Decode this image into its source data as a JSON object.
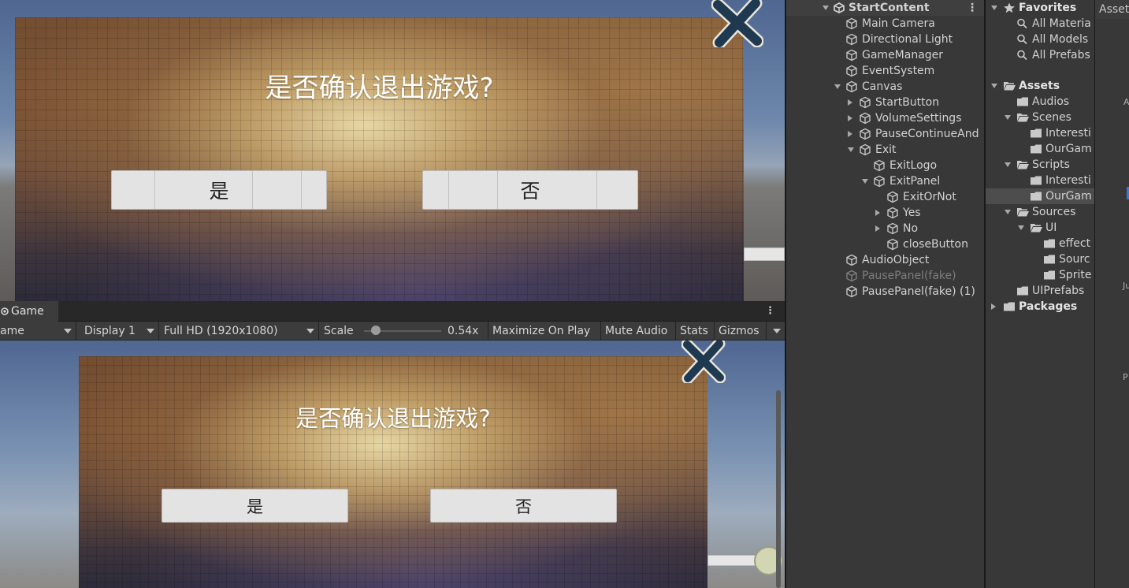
{
  "scene": {
    "dialog_title": "是否确认退出游戏?",
    "yes_label": "是",
    "no_label": "否"
  },
  "game": {
    "tab_label": "Game",
    "toolbar": {
      "view_mode": "ame",
      "display": "Display 1",
      "resolution": "Full HD (1920x1080)",
      "scale_label": "Scale",
      "scale_value": "0.54x",
      "maximize": "Maximize On Play",
      "mute": "Mute Audio",
      "stats": "Stats",
      "gizmos": "Gizmos"
    },
    "dialog_title": "是否确认退出游戏?",
    "yes_label": "是",
    "no_label": "否"
  },
  "hierarchy": {
    "scene_name": "StartContent",
    "items": [
      {
        "label": "Main Camera"
      },
      {
        "label": "Directional Light"
      },
      {
        "label": "GameManager"
      },
      {
        "label": "EventSystem"
      },
      {
        "label": "Canvas"
      },
      {
        "label": "StartButton"
      },
      {
        "label": "VolumeSettings"
      },
      {
        "label": "PauseContinueAnd"
      },
      {
        "label": "Exit"
      },
      {
        "label": "ExitLogo"
      },
      {
        "label": "ExitPanel"
      },
      {
        "label": "ExitOrNot"
      },
      {
        "label": "Yes"
      },
      {
        "label": "No"
      },
      {
        "label": "closeButton"
      },
      {
        "label": "AudioObject"
      },
      {
        "label": "PausePanel(fake)"
      },
      {
        "label": "PausePanel(fake) (1)"
      }
    ]
  },
  "project": {
    "items": [
      {
        "label": "Favorites"
      },
      {
        "label": "All Materia"
      },
      {
        "label": "All Models"
      },
      {
        "label": "All Prefabs"
      },
      {
        "label": "Assets"
      },
      {
        "label": "Audios"
      },
      {
        "label": "Scenes"
      },
      {
        "label": "Interesti"
      },
      {
        "label": "OurGam"
      },
      {
        "label": "Scripts"
      },
      {
        "label": "Interesti"
      },
      {
        "label": "OurGam"
      },
      {
        "label": "Sources"
      },
      {
        "label": "UI"
      },
      {
        "label": "effect"
      },
      {
        "label": "Sourc"
      },
      {
        "label": "Sprite"
      },
      {
        "label": "UIPrefabs"
      },
      {
        "label": "Packages"
      }
    ]
  },
  "inspector_strip": {
    "tab_label": "Asset",
    "letters": [
      "A",
      "Ju",
      "P"
    ]
  },
  "colors": {
    "editor_bg": "#383838",
    "toolbar_bg": "#3c3c3c",
    "selection": "#4d4d4d",
    "close_x": "#1f3a50",
    "button_face": "#e3e3e3",
    "accent_blue": "#3a79d3"
  }
}
